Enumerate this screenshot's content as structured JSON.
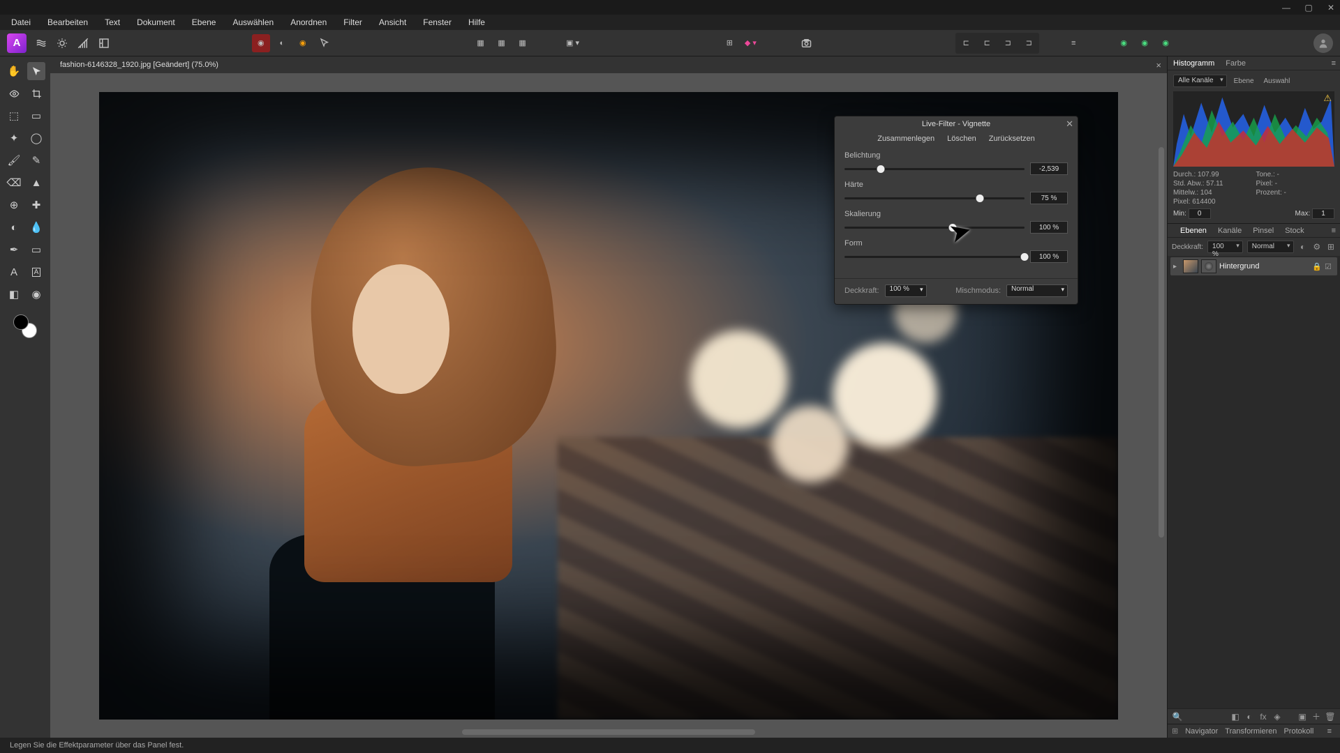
{
  "menu": [
    "Datei",
    "Bearbeiten",
    "Text",
    "Dokument",
    "Ebene",
    "Auswählen",
    "Anordnen",
    "Filter",
    "Ansicht",
    "Fenster",
    "Hilfe"
  ],
  "doc_tab": "fashion-6146328_1920.jpg [Geändert] (75.0%)",
  "dialog": {
    "title": "Live-Filter - Vignette",
    "actions": [
      "Zusammenlegen",
      "Löschen",
      "Zurücksetzen"
    ],
    "sliders": {
      "exposure": {
        "label": "Belichtung",
        "value": "-2,539",
        "pos": 20
      },
      "hardness": {
        "label": "Härte",
        "value": "75 %",
        "pos": 75
      },
      "scale": {
        "label": "Skalierung",
        "value": "100 %",
        "pos": 60
      },
      "shape": {
        "label": "Form",
        "value": "100 %",
        "pos": 100
      }
    },
    "opacity_label": "Deckkraft:",
    "opacity_value": "100 %",
    "blend_label": "Mischmodus:",
    "blend_value": "Normal"
  },
  "right": {
    "tabs_top": [
      "Histogramm",
      "Farbe"
    ],
    "channel_select": "Alle Kanäle",
    "btn_ebene": "Ebene",
    "btn_auswahl": "Auswahl",
    "stats": {
      "durch": "Durch.: 107.99",
      "tone": "Tone.: -",
      "stdabw": "Std. Abw.: 57.11",
      "pixelp": "Pixel: -",
      "mittelw": "Mittelw.: 104",
      "prozent": "Prozent: -",
      "pixel": "Pixel: 614400"
    },
    "min_label": "Min:",
    "min_val": "0",
    "max_label": "Max:",
    "max_val": "1",
    "tabs_mid": [
      "Ebenen",
      "Kanäle",
      "Pinsel",
      "Stock"
    ],
    "layer_opacity_label": "Deckkraft:",
    "layer_opacity_val": "100 %",
    "layer_blend": "Normal",
    "layer_name": "Hintergrund",
    "tabs_bottom": [
      "Navigator",
      "Transformieren",
      "Protokoll"
    ]
  },
  "status": "Legen Sie die Effektparameter über das Panel fest."
}
